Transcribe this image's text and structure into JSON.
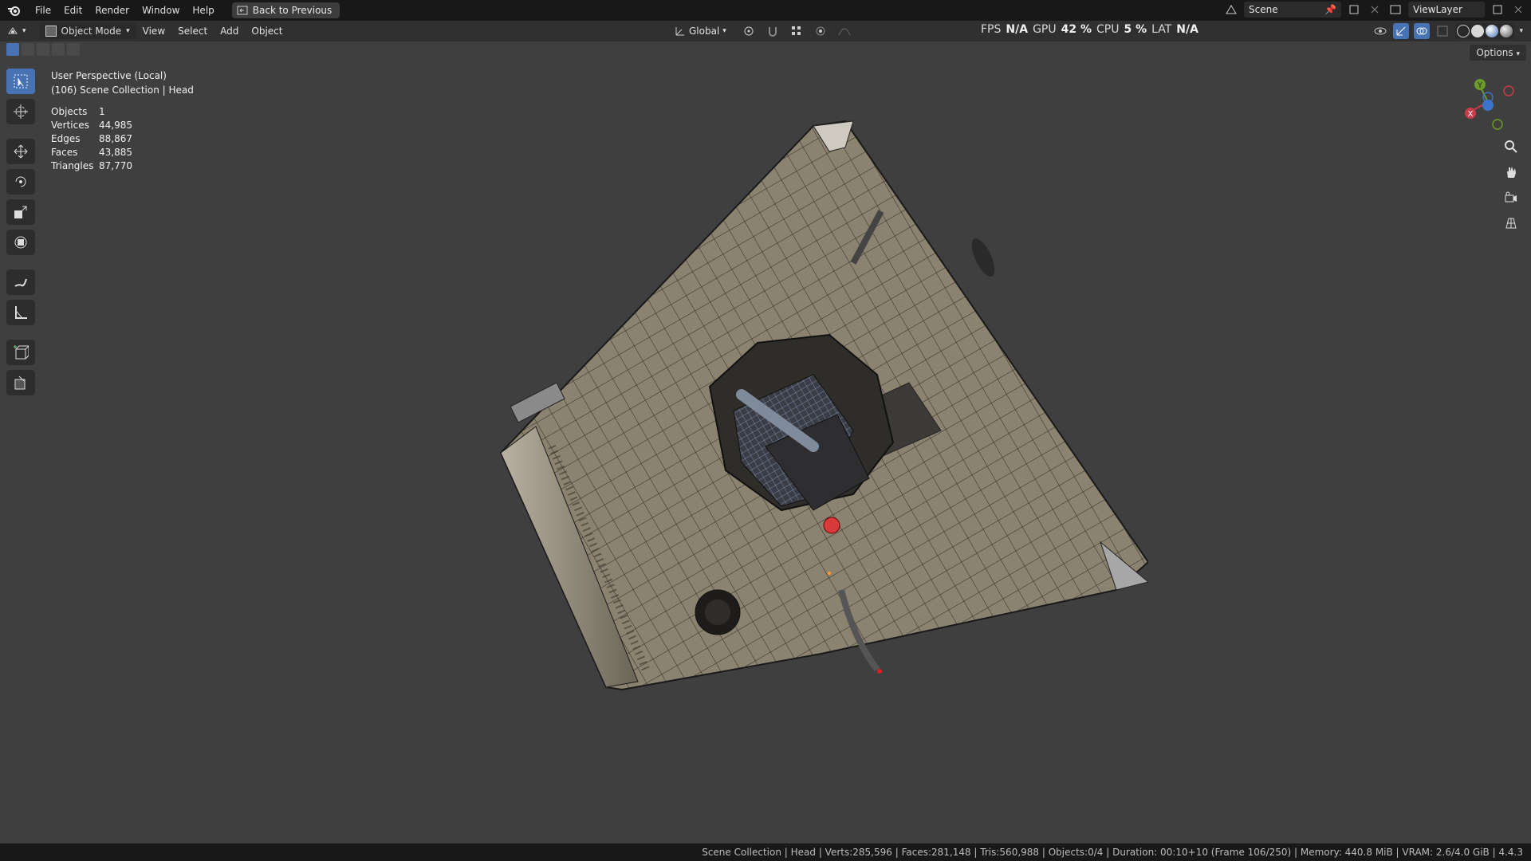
{
  "topbar": {
    "menus": [
      "File",
      "Edit",
      "Render",
      "Window",
      "Help"
    ],
    "back_label": "Back to Previous",
    "scene_label": "Scene",
    "viewlayer_label": "ViewLayer"
  },
  "header": {
    "mode_label": "Object Mode",
    "menus": [
      "View",
      "Select",
      "Add",
      "Object"
    ],
    "orientation_label": "Global",
    "options_label": "Options"
  },
  "perf": {
    "fps_label": "FPS",
    "fps_value": "N/A",
    "gpu_label": "GPU",
    "gpu_value": "42 %",
    "cpu_label": "CPU",
    "cpu_value": "5 %",
    "lat_label": "LAT",
    "lat_value": "N/A"
  },
  "viewport": {
    "view_name": "User Perspective (Local)",
    "collection_line": "(106) Scene Collection | Head",
    "stats": [
      {
        "label": "Objects",
        "value": "1"
      },
      {
        "label": "Vertices",
        "value": "44,985"
      },
      {
        "label": "Edges",
        "value": "88,867"
      },
      {
        "label": "Faces",
        "value": "43,885"
      },
      {
        "label": "Triangles",
        "value": "87,770"
      }
    ]
  },
  "gizmo": {
    "x_label": "X",
    "y_label": "Y"
  },
  "colors": {
    "accent": "#4772b3",
    "viewport_bg": "#3f3f3f",
    "axis_x": "#c83c4b",
    "axis_y": "#6b9c2a",
    "axis_z": "#3b74c9"
  },
  "statusbar": {
    "text": "Scene Collection | Head | Verts:285,596 | Faces:281,148 | Tris:560,988 | Objects:0/4 | Duration: 00:10+10 (Frame 106/250) | Memory: 440.8 MiB | VRAM: 2.6/4.0 GiB | 4.4.3"
  }
}
